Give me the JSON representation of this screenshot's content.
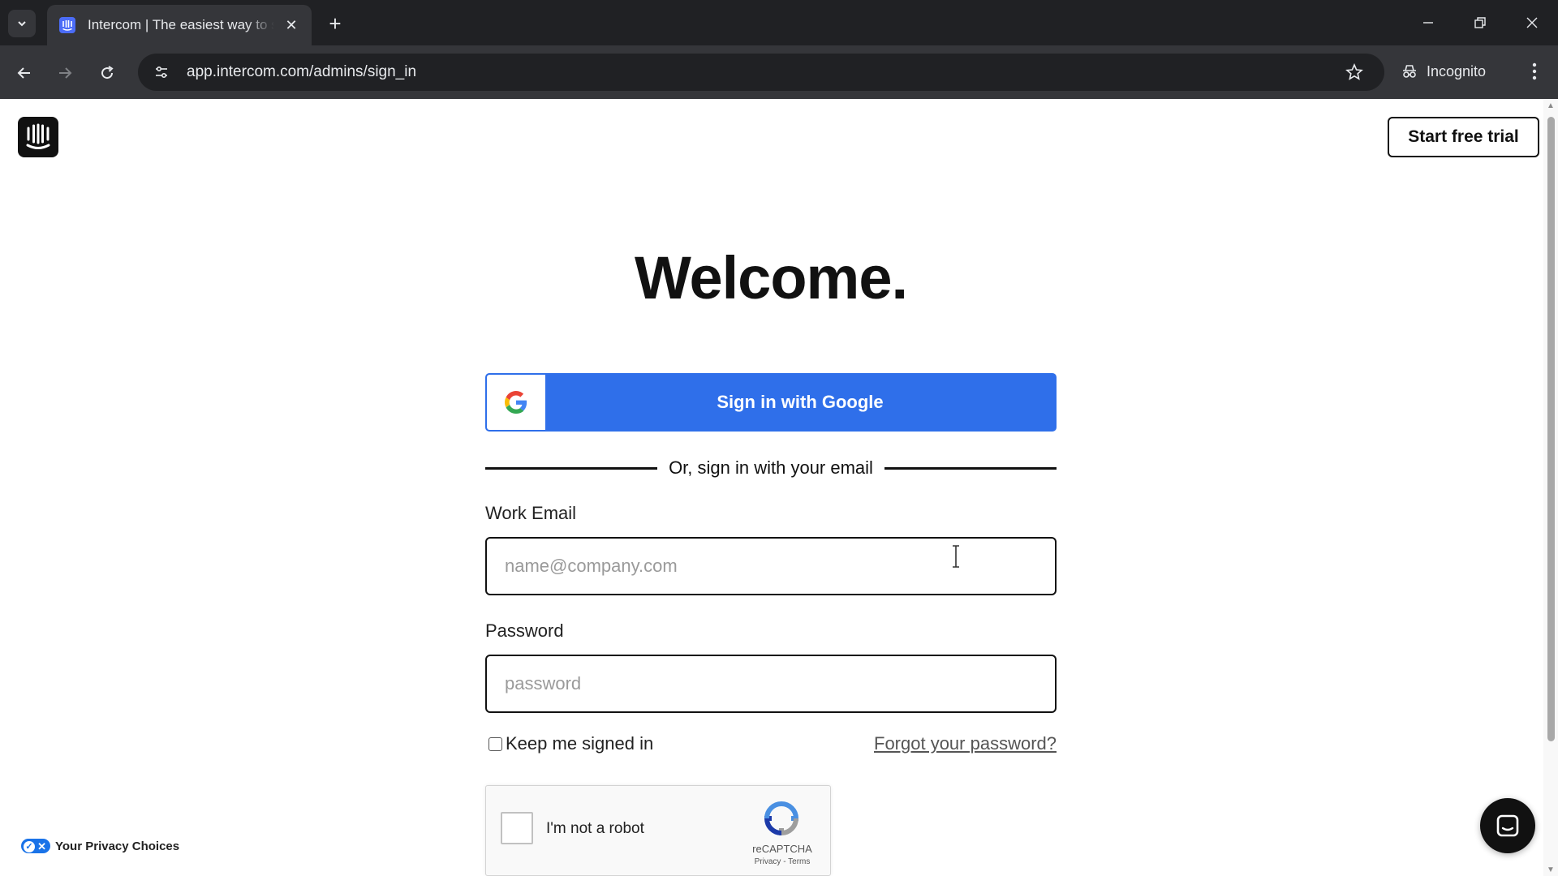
{
  "browser": {
    "tab_title": "Intercom | The easiest way to se",
    "url": "app.intercom.com/admins/sign_in",
    "incognito_label": "Incognito",
    "icons": {
      "tab_search": "chevron-down-icon",
      "tab_close": "close-icon",
      "new_tab": "plus-icon",
      "back": "arrow-left-icon",
      "forward": "arrow-right-icon",
      "reload": "reload-icon",
      "site_info": "tune-icon",
      "bookmark": "star-icon",
      "menu": "more-vertical-icon"
    }
  },
  "header": {
    "logo": "intercom-logo",
    "trial_button": "Start free trial"
  },
  "main": {
    "title": "Welcome.",
    "google_button": "Sign in with Google",
    "divider_text": "Or, sign in with your email",
    "email": {
      "label": "Work Email",
      "placeholder": "name@company.com",
      "value": ""
    },
    "password": {
      "label": "Password",
      "placeholder": "password",
      "value": ""
    },
    "keep_signed_in": "Keep me signed in",
    "forgot_password": "Forgot your password?",
    "recaptcha": {
      "label": "I'm not a robot",
      "brand": "reCAPTCHA",
      "terms": "Privacy - Terms"
    }
  },
  "footer": {
    "privacy_choices": "Your Privacy Choices"
  },
  "colors": {
    "google_blue": "#2f6fea",
    "chrome_dark": "#202124",
    "chrome_toolbar": "#35363a",
    "text": "#111111"
  }
}
